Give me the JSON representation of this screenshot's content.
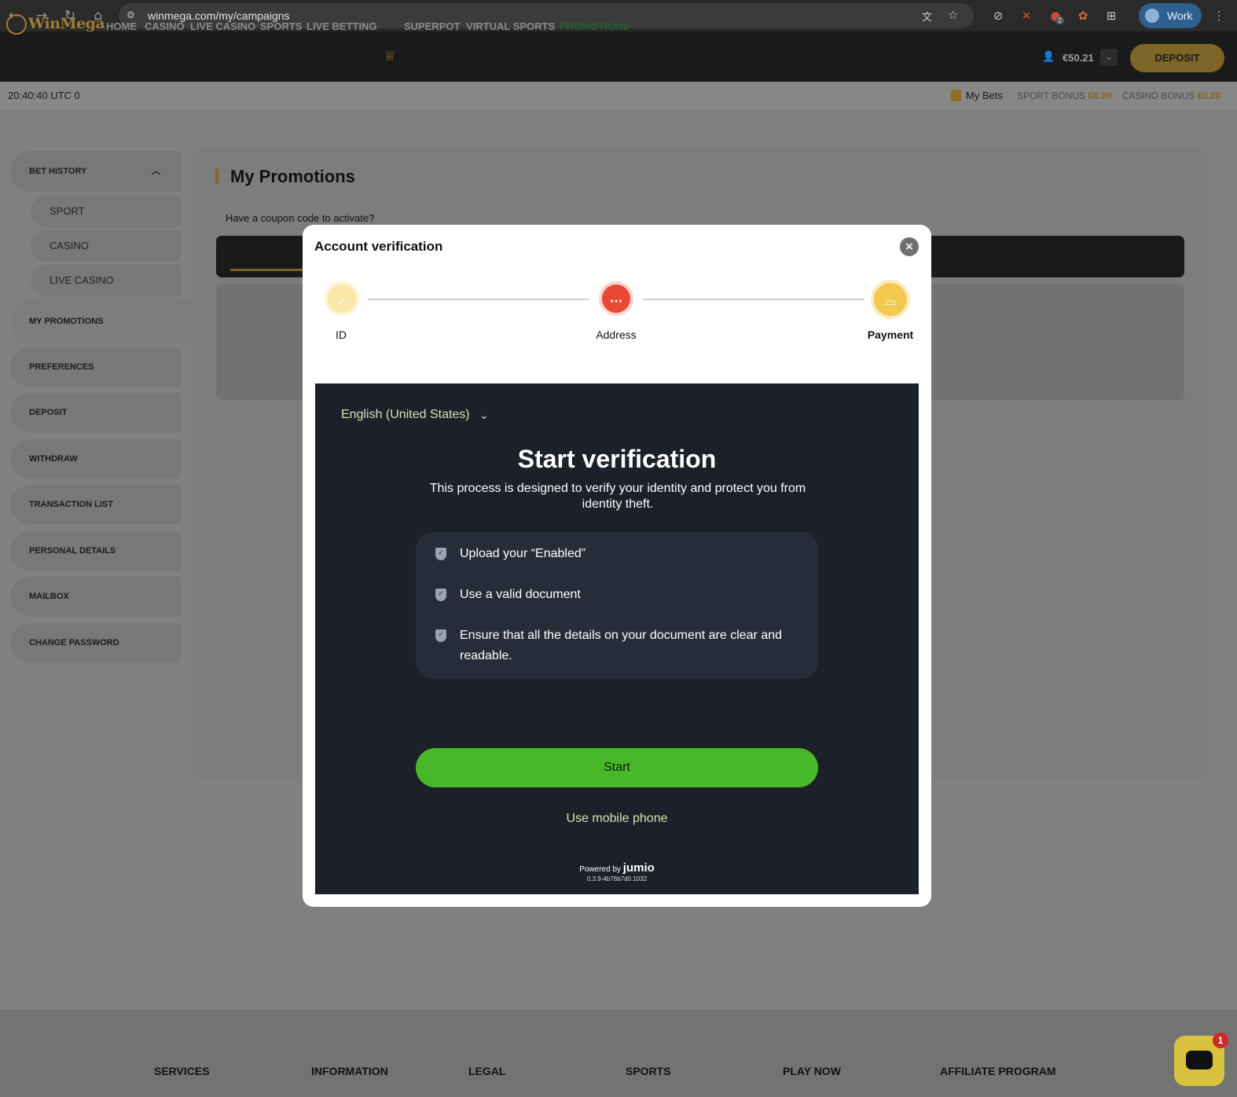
{
  "browser": {
    "url": "winmega.com/my/campaigns",
    "profile_label": "Work",
    "extension_badge": "2"
  },
  "site": {
    "logo_text": "WinMega",
    "nav": [
      "HOME",
      "CASINO",
      "LIVE CASINO",
      "SPORTS",
      "LIVE BETTING",
      "SUPERPOT",
      "VIRTUAL SPORTS",
      "PROMOTIONS"
    ],
    "active_nav": "PROMOTIONS",
    "balance": "€50.21",
    "deposit_label": "DEPOSIT",
    "colors": {
      "accent_gold": "#c9a33f",
      "active_green": "#2f8a3c",
      "overlay": "#808080"
    }
  },
  "subbar": {
    "clock": "20:40:40 UTC 0",
    "my_bets": "My Bets",
    "sport_bonus_label": "SPORT BONUS",
    "sport_bonus_value": "€0.00",
    "casino_bonus_label": "CASINO BONUS",
    "casino_bonus_value": "€0.00"
  },
  "sidebar": {
    "bet_history": "BET HISTORY",
    "bet_history_items": [
      "SPORT",
      "CASINO",
      "LIVE CASINO"
    ],
    "items": [
      "MY PROMOTIONS",
      "PREFERENCES",
      "DEPOSIT",
      "WITHDRAW",
      "TRANSACTION LIST",
      "PERSONAL DETAILS",
      "MAILBOX",
      "CHANGE PASSWORD"
    ]
  },
  "main": {
    "title": "My Promotions",
    "coupon_prompt": "Have a coupon code to activate?"
  },
  "footer": {
    "columns": [
      "SERVICES",
      "INFORMATION",
      "LEGAL",
      "SPORTS",
      "PLAY NOW",
      "AFFILIATE PROGRAM"
    ],
    "chat_badge": "1"
  },
  "modal": {
    "title": "Account verification",
    "close_icon": "×",
    "steps": [
      {
        "label": "ID",
        "status": "done",
        "icon": "check-icon",
        "color": "#f3c94f"
      },
      {
        "label": "Address",
        "status": "in-progress",
        "icon": "ellipsis-icon",
        "color": "#e84a35"
      },
      {
        "label": "Payment",
        "status": "current",
        "icon": "card-icon",
        "color": "#f3c94f"
      }
    ]
  },
  "jumio": {
    "language": "English (United States)",
    "heading": "Start verification",
    "description": "This process is designed to verify your identity and protect you from identity theft.",
    "checklist": [
      "Upload your “Enabled”",
      "Use a valid document",
      "Ensure that all the details on your document are clear and readable."
    ],
    "start_label": "Start",
    "mobile_label": "Use mobile phone",
    "powered_by": "Powered by",
    "brand": "jumio",
    "version": "0.3.9-4b76b7d0.1032",
    "colors": {
      "start_button": "#52d22e",
      "link": "#d9ffc0",
      "background": "#1c2028"
    }
  }
}
